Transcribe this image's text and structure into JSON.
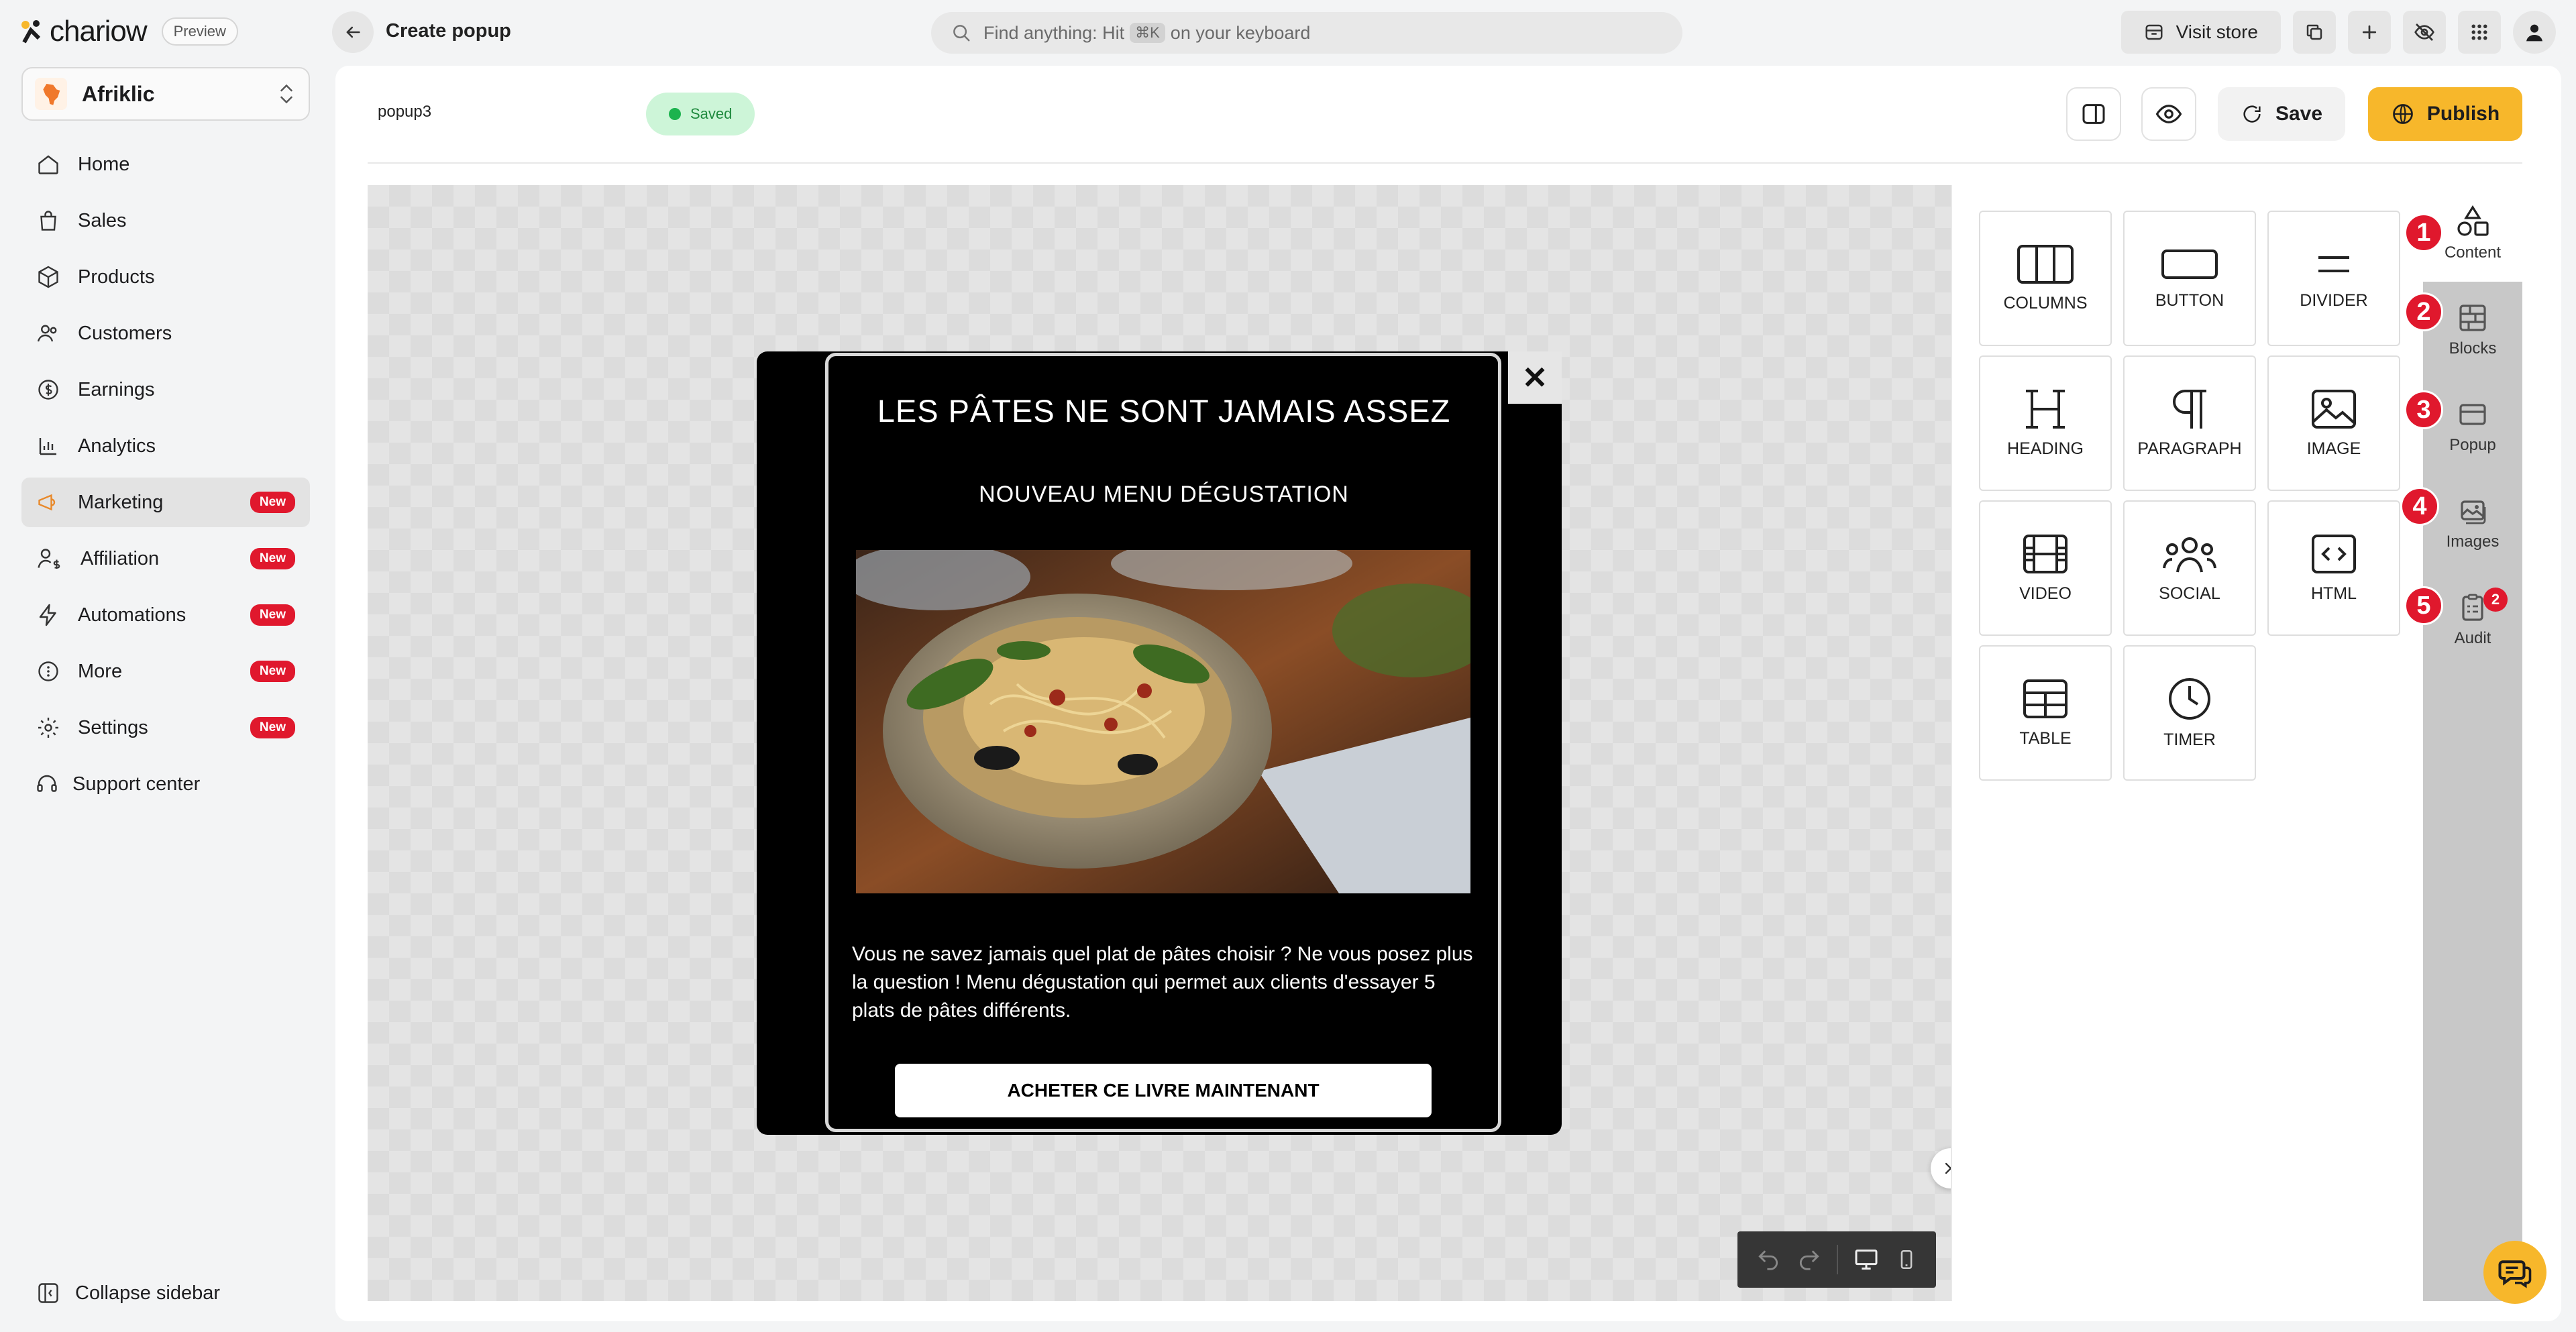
{
  "app": {
    "name": "chariow",
    "preview_label": "Preview"
  },
  "header": {
    "page_title": "Create popup",
    "search_placeholder_prefix": "Find anything: Hit",
    "search_shortcut": "⌘K",
    "search_placeholder_suffix": "on your keyboard",
    "visit_store_label": "Visit store"
  },
  "store": {
    "name": "Afriklic"
  },
  "sidebar": {
    "items": [
      {
        "label": "Home",
        "icon": "home-icon",
        "active": false,
        "badge": ""
      },
      {
        "label": "Sales",
        "icon": "bag-icon",
        "active": false,
        "badge": ""
      },
      {
        "label": "Products",
        "icon": "box-icon",
        "active": false,
        "badge": ""
      },
      {
        "label": "Customers",
        "icon": "users-icon",
        "active": false,
        "badge": ""
      },
      {
        "label": "Earnings",
        "icon": "dollar-icon",
        "active": false,
        "badge": ""
      },
      {
        "label": "Analytics",
        "icon": "chart-icon",
        "active": false,
        "badge": ""
      },
      {
        "label": "Marketing",
        "icon": "megaphone-icon",
        "active": true,
        "badge": "New"
      },
      {
        "label": "Affiliation",
        "icon": "affiliate-icon",
        "active": false,
        "badge": "New"
      },
      {
        "label": "Automations",
        "icon": "bolt-icon",
        "active": false,
        "badge": "New"
      },
      {
        "label": "More",
        "icon": "more-icon",
        "active": false,
        "badge": "New"
      },
      {
        "label": "Settings",
        "icon": "gear-icon",
        "active": false,
        "badge": "New"
      },
      {
        "label": "Support center",
        "icon": "headset-icon",
        "active": false,
        "badge": ""
      }
    ],
    "collapse_label": "Collapse sidebar"
  },
  "editor": {
    "popup_name": "popup3",
    "status": "Saved",
    "save_label": "Save",
    "publish_label": "Publish"
  },
  "popup": {
    "heading": "LES PÂTES NE SONT JAMAIS ASSEZ",
    "subheading": "NOUVEAU MENU DÉGUSTATION",
    "body": "Vous ne savez jamais quel plat de pâtes choisir ? Ne vous posez plus la question !  Menu dégustation qui permet aux clients d'essayer 5 plats de pâtes différents.",
    "cta": "ACHETER CE LIVRE MAINTENANT",
    "close_symbol": "✕"
  },
  "content_tiles": [
    {
      "label": "COLUMNS",
      "icon": "columns-icon"
    },
    {
      "label": "BUTTON",
      "icon": "button-icon"
    },
    {
      "label": "DIVIDER",
      "icon": "divider-icon"
    },
    {
      "label": "HEADING",
      "icon": "heading-icon"
    },
    {
      "label": "PARAGRAPH",
      "icon": "paragraph-icon"
    },
    {
      "label": "IMAGE",
      "icon": "image-icon"
    },
    {
      "label": "VIDEO",
      "icon": "video-icon"
    },
    {
      "label": "SOCIAL",
      "icon": "social-icon"
    },
    {
      "label": "HTML",
      "icon": "html-icon"
    },
    {
      "label": "TABLE",
      "icon": "table-icon"
    },
    {
      "label": "TIMER",
      "icon": "timer-icon"
    }
  ],
  "tabs": [
    {
      "label": "Content",
      "number": "1",
      "icon": "shapes-icon",
      "active": true
    },
    {
      "label": "Blocks",
      "number": "2",
      "icon": "blocks-icon",
      "active": false
    },
    {
      "label": "Popup",
      "number": "3",
      "icon": "popup-icon",
      "active": false
    },
    {
      "label": "Images",
      "number": "4",
      "icon": "images-icon",
      "active": false
    },
    {
      "label": "Audit",
      "number": "5",
      "icon": "audit-icon",
      "active": false,
      "count": "2"
    }
  ],
  "colors": {
    "accent": "#f7b72b",
    "badge": "#e0182d",
    "saved_bg": "#cdf5d8",
    "saved_text": "#1f8a3e"
  }
}
